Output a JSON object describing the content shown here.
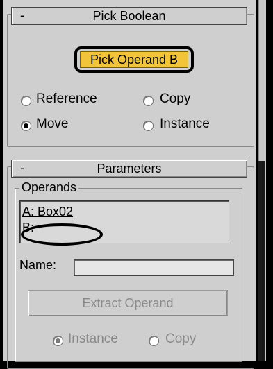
{
  "pick_boolean": {
    "minus": "-",
    "title": "Pick Boolean",
    "pick_button_label": "Pick Operand B",
    "radios": [
      {
        "label": "Reference",
        "checked": false
      },
      {
        "label": "Copy",
        "checked": false
      },
      {
        "label": "Move",
        "checked": true
      },
      {
        "label": "Instance",
        "checked": false
      }
    ]
  },
  "parameters": {
    "minus": "-",
    "title": "Parameters",
    "operands_legend": "Operands",
    "operands": [
      "A: Box02",
      "B:"
    ],
    "name_label": "Name:",
    "name_value": "",
    "extract_button_label": "Extract Operand",
    "extract_radios": [
      {
        "label": "Instance",
        "checked": true
      },
      {
        "label": "Copy",
        "checked": false
      }
    ]
  }
}
